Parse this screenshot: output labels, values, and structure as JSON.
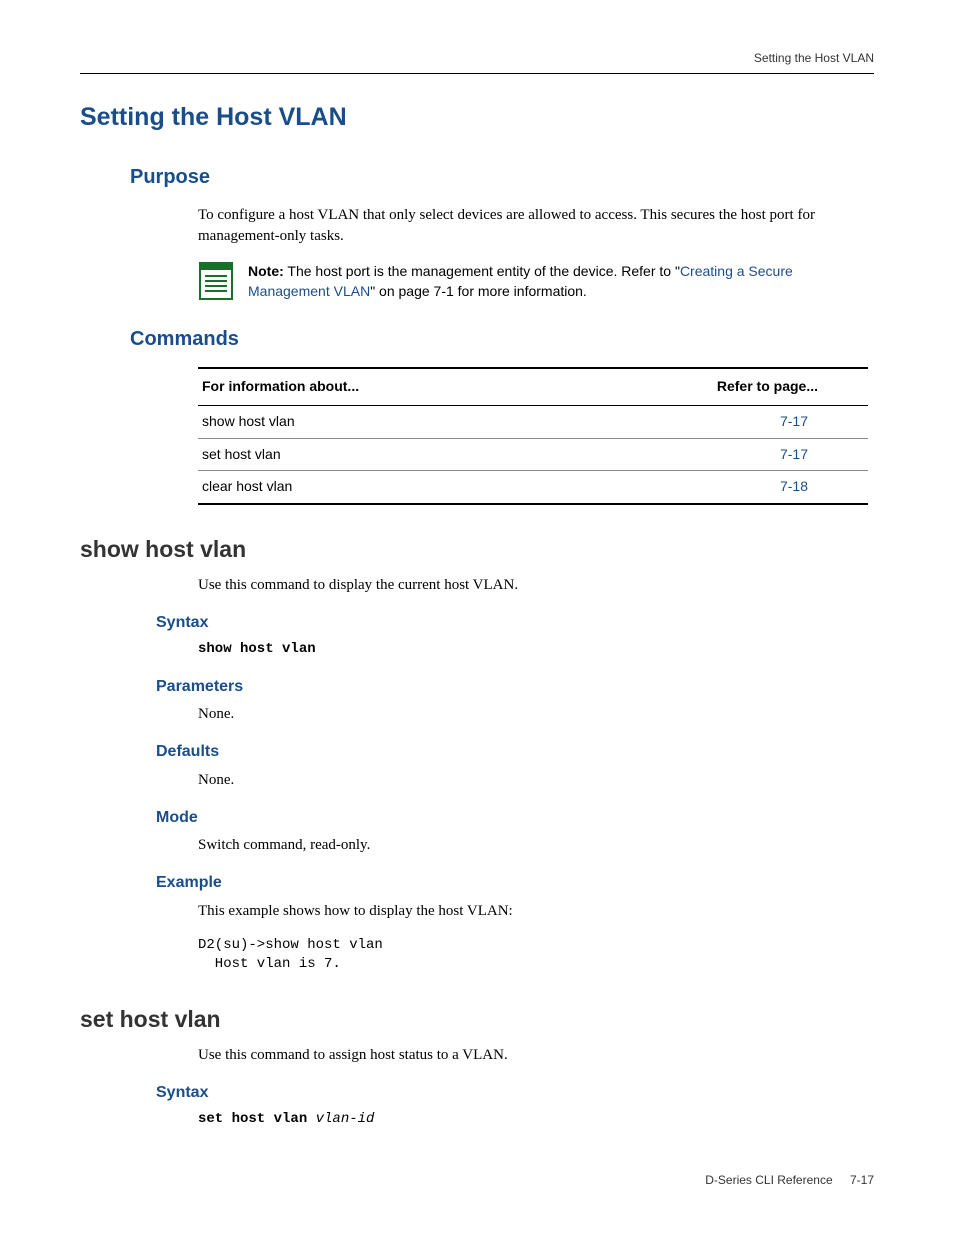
{
  "running_header": "Setting the Host VLAN",
  "title": "Setting the Host VLAN",
  "purpose": {
    "heading": "Purpose",
    "text": "To configure a host VLAN that only select devices are allowed to access. This secures the host port for management-only tasks."
  },
  "note": {
    "prefix": "Note:",
    "body_before_link": " The host port is the management entity of the device. Refer to \"",
    "link_text": "Creating a Secure Management VLAN",
    "body_after_link": "\" on page 7-1 for more information."
  },
  "commands": {
    "heading": "Commands",
    "col1": "For information about...",
    "col2": "Refer to page...",
    "rows": [
      {
        "name": "show host vlan",
        "page": "7-17"
      },
      {
        "name": "set host vlan",
        "page": "7-17"
      },
      {
        "name": "clear host vlan",
        "page": "7-18"
      }
    ]
  },
  "show_host_vlan": {
    "heading": "show host vlan",
    "intro": "Use this command to display the current host VLAN.",
    "syntax_h": "Syntax",
    "syntax": "show host vlan",
    "parameters_h": "Parameters",
    "parameters": "None.",
    "defaults_h": "Defaults",
    "defaults": "None.",
    "mode_h": "Mode",
    "mode": "Switch command, read-only.",
    "example_h": "Example",
    "example_intro": "This example shows how to display the host VLAN:",
    "example_code": "D2(su)->show host vlan\n  Host vlan is 7."
  },
  "set_host_vlan": {
    "heading": "set host vlan",
    "intro": "Use this command to assign host status to a VLAN.",
    "syntax_h": "Syntax",
    "syntax_cmd": "set host vlan",
    "syntax_arg": " vlan-id"
  },
  "footer": {
    "doc": "D-Series CLI Reference",
    "page": "7-17"
  }
}
